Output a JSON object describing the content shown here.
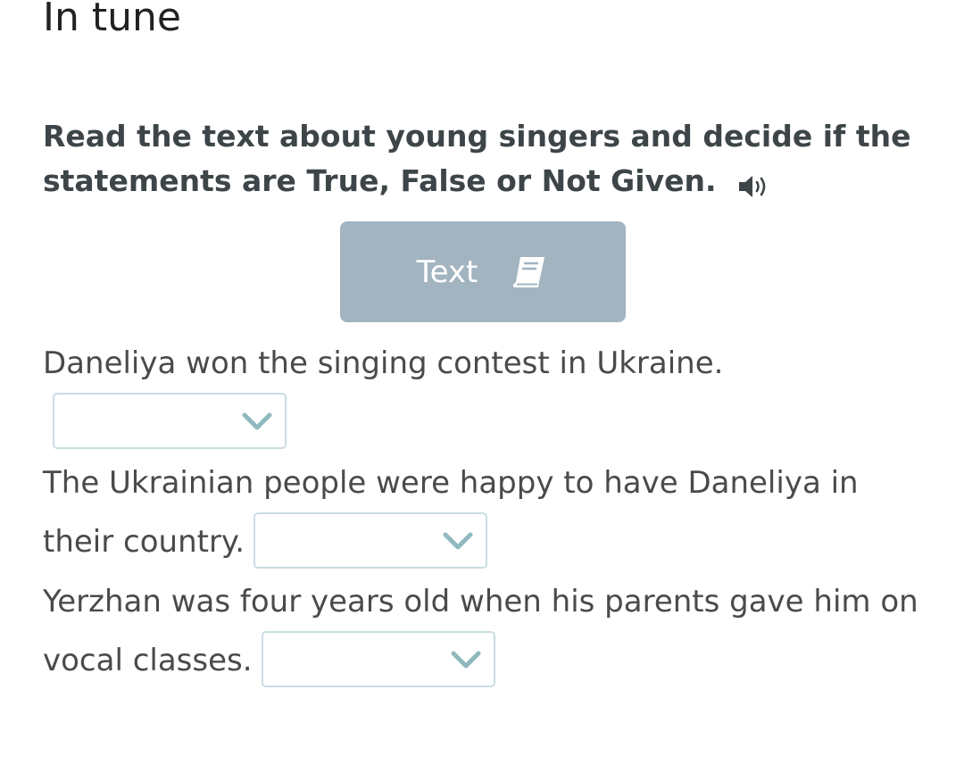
{
  "header": {
    "title": "In tune"
  },
  "instruction": {
    "text": "Read the text about young singers and decide if the statements are True, False or Not Given."
  },
  "icons": {
    "audio": "speaker-icon",
    "text_button": "book-icon",
    "dropdown": "chevron-down-icon"
  },
  "text_button": {
    "label": "Text"
  },
  "questions": [
    {
      "text": "Daneliya won the singing contest in Ukraine.",
      "selected": ""
    },
    {
      "text": "The Ukrainian people were happy to have Daneliya in their country.",
      "selected": ""
    },
    {
      "text": "Yerzhan was four years old when his parents gave him on vocal classes.",
      "selected": ""
    }
  ],
  "colors": {
    "button_bg": "#a2b4c0",
    "dropdown_border": "#c9dde1",
    "chevron": "#8fb9bf",
    "heading_text": "#3d4548"
  }
}
